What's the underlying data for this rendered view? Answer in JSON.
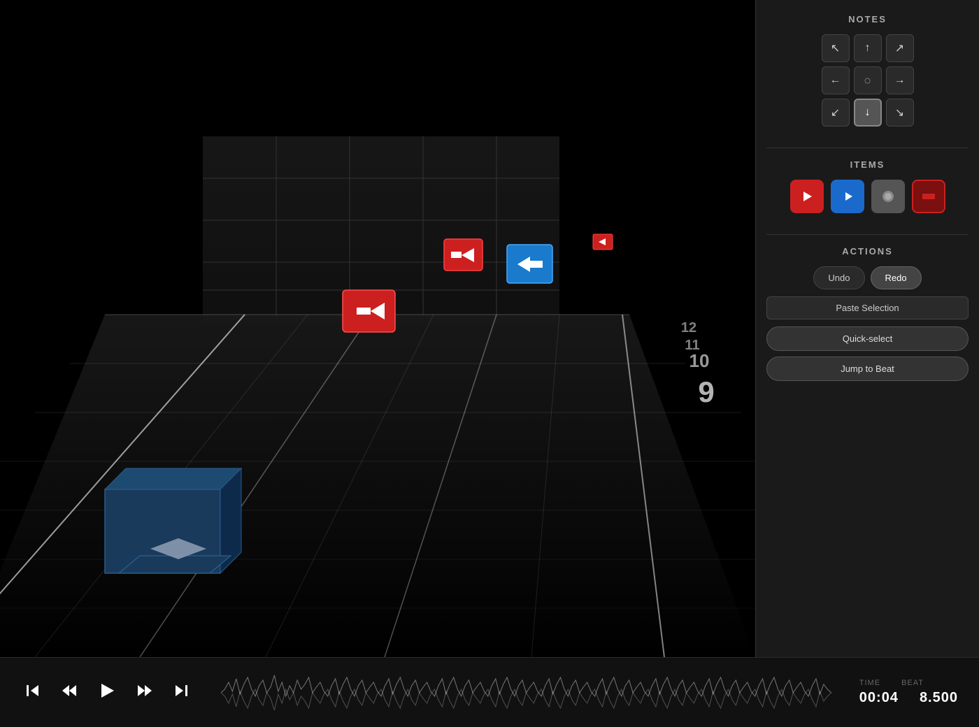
{
  "scene": {
    "beat_numbers": [
      "12",
      "11",
      "10",
      "9"
    ],
    "beat_large": "9"
  },
  "panel": {
    "sections": {
      "notes": {
        "title": "NOTES",
        "grid": [
          {
            "pos": "top-left",
            "arrow": "↖",
            "active": false
          },
          {
            "pos": "top-center",
            "arrow": "↑",
            "active": false
          },
          {
            "pos": "top-right",
            "arrow": "↗",
            "active": false
          },
          {
            "pos": "mid-left",
            "arrow": "←",
            "active": false
          },
          {
            "pos": "mid-center",
            "arrow": "○",
            "active": false
          },
          {
            "pos": "mid-right",
            "arrow": "→",
            "active": false
          },
          {
            "pos": "bot-left",
            "arrow": "↙",
            "active": false
          },
          {
            "pos": "bot-center",
            "arrow": "↓",
            "active": true,
            "highlighted": true
          },
          {
            "pos": "bot-right",
            "arrow": "↘",
            "active": false
          }
        ]
      },
      "items": {
        "title": "ITEMS",
        "buttons": [
          {
            "id": "red-note",
            "type": "red",
            "symbol": "▶"
          },
          {
            "id": "blue-note",
            "type": "blue",
            "symbol": "▶"
          },
          {
            "id": "bomb",
            "type": "gray",
            "symbol": "●"
          },
          {
            "id": "wall",
            "type": "dark-red",
            "symbol": "▬"
          }
        ]
      },
      "actions": {
        "title": "ACTIONS",
        "undo_label": "Undo",
        "redo_label": "Redo",
        "paste_label": "Paste Selection",
        "quick_select_label": "Quick-select",
        "jump_to_beat_label": "Jump to Beat"
      }
    }
  },
  "transport": {
    "skip_back_label": "⏮",
    "rewind_label": "⏪",
    "play_label": "▶",
    "fast_forward_label": "⏩",
    "skip_forward_label": "⏭"
  },
  "time_display": {
    "time_label": "TIME",
    "beat_label": "BEAT",
    "time_value": "00:04",
    "beat_value": "8.500"
  }
}
